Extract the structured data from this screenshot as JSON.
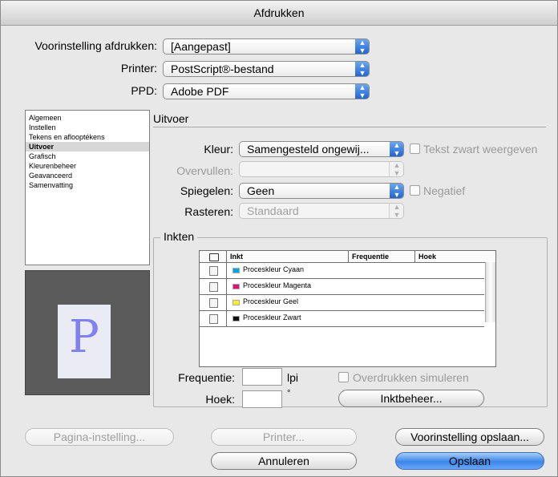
{
  "window": {
    "title": "Afdrukken"
  },
  "top": {
    "preset_label": "Voorinstelling afdrukken:",
    "preset_value": "[Aangepast]",
    "printer_label": "Printer:",
    "printer_value": "PostScript®-bestand",
    "ppd_label": "PPD:",
    "ppd_value": "Adobe PDF"
  },
  "sidebar": {
    "items": [
      {
        "label": "Algemeen"
      },
      {
        "label": "Instellen"
      },
      {
        "label": "Tekens en aflooptékens"
      },
      {
        "label": "Uitvoer"
      },
      {
        "label": "Grafisch"
      },
      {
        "label": "Kleurenbeheer"
      },
      {
        "label": "Geavanceerd"
      },
      {
        "label": "Samenvatting"
      }
    ],
    "selected": "Uitvoer"
  },
  "preview": {
    "letter": "P"
  },
  "output": {
    "section_title": "Uitvoer",
    "kleur_label": "Kleur:",
    "kleur_value": "Samengesteld ongewij...",
    "tekst_zwart_label": "Tekst zwart weergeven",
    "overvullen_label": "Overvullen:",
    "overvullen_value": "",
    "spiegelen_label": "Spiegelen:",
    "spiegelen_value": "Geen",
    "negatief_label": "Negatief",
    "rasteren_label": "Rasteren:",
    "rasteren_value": "Standaard"
  },
  "inks": {
    "group_title": "Inkten",
    "columns": [
      "Inkt",
      "Frequentie",
      "Hoek"
    ],
    "rows": [
      {
        "name": "Proceskleur Cyaan",
        "color": "#00a6e8"
      },
      {
        "name": "Proceskleur Magenta",
        "color": "#e0107a"
      },
      {
        "name": "Proceskleur Geel",
        "color": "#f8ef2a"
      },
      {
        "name": "Proceskleur Zwart",
        "color": "#111111"
      }
    ],
    "frequentie_label": "Frequentie:",
    "frequentie_value": "",
    "frequentie_unit": "lpi",
    "hoek_label": "Hoek:",
    "hoek_value": "",
    "hoek_unit": "°",
    "overdrukken_label": "Overdrukken simuleren",
    "inktbeheer_label": "Inktbeheer..."
  },
  "buttons": {
    "pagina_instelling": "Pagina-instelling...",
    "printer": "Printer...",
    "voorinstelling_opslaan": "Voorinstelling opslaan...",
    "annuleren": "Annuleren",
    "opslaan": "Opslaan"
  }
}
